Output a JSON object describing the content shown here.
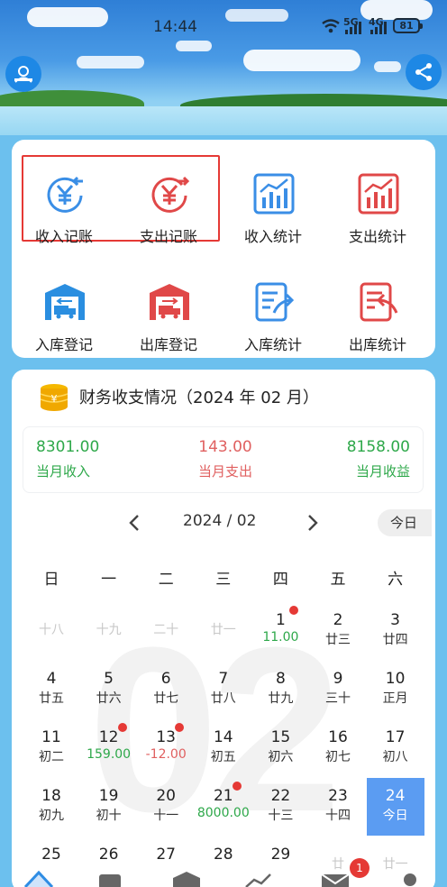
{
  "status_bar": {
    "time": "14:44",
    "network_1": "5G",
    "network_2": "4G",
    "battery": "81"
  },
  "icons": {
    "avatar": "user-icon",
    "share": "share-icon"
  },
  "menu": {
    "items": [
      {
        "label": "收入记账",
        "icon": "income-yen-icon",
        "color": "#3a8ee6"
      },
      {
        "label": "支出记账",
        "icon": "expense-yen-icon",
        "color": "#e04848"
      },
      {
        "label": "收入统计",
        "icon": "income-chart-icon",
        "color": "#3a8ee6"
      },
      {
        "label": "支出统计",
        "icon": "expense-chart-icon",
        "color": "#e04848"
      },
      {
        "label": "入库登记",
        "icon": "inbound-warehouse-icon",
        "color": "#2a8ee0"
      },
      {
        "label": "出库登记",
        "icon": "outbound-warehouse-icon",
        "color": "#e04848"
      },
      {
        "label": "入库统计",
        "icon": "inbound-stats-icon",
        "color": "#3a8ee6"
      },
      {
        "label": "出库统计",
        "icon": "outbound-stats-icon",
        "color": "#e04848"
      }
    ]
  },
  "finance": {
    "title": "财务收支情况（2024 年 02 月）",
    "income_value": "8301.00",
    "income_label": "当月收入",
    "expense_value": "143.00",
    "expense_label": "当月支出",
    "profit_value": "8158.00",
    "profit_label": "当月收益",
    "colors": {
      "income": "#2ea84a",
      "expense": "#e06060",
      "profit": "#2ea84a"
    }
  },
  "calendar": {
    "month_label": "2024 / 02",
    "today_label": "今日",
    "background_number": "02",
    "weekdays": [
      "日",
      "一",
      "二",
      "三",
      "四",
      "五",
      "六"
    ],
    "rows": [
      [
        {
          "n": "",
          "l": "十八",
          "faded": true
        },
        {
          "n": "",
          "l": "十九",
          "faded": true
        },
        {
          "n": "",
          "l": "二十",
          "faded": true
        },
        {
          "n": "",
          "l": "廿一",
          "faded": true
        },
        {
          "n": "1",
          "l": "11.00",
          "amount": "income",
          "dot": true
        },
        {
          "n": "2",
          "l": "廿三"
        },
        {
          "n": "3",
          "l": "廿四"
        }
      ],
      [
        {
          "n": "4",
          "l": "廿五"
        },
        {
          "n": "5",
          "l": "廿六"
        },
        {
          "n": "6",
          "l": "廿七"
        },
        {
          "n": "7",
          "l": "廿八"
        },
        {
          "n": "8",
          "l": "廿九"
        },
        {
          "n": "9",
          "l": "三十"
        },
        {
          "n": "10",
          "l": "正月"
        }
      ],
      [
        {
          "n": "11",
          "l": "初二"
        },
        {
          "n": "12",
          "l": "159.00",
          "amount": "income",
          "dot": true
        },
        {
          "n": "13",
          "l": "-12.00",
          "amount": "expense",
          "dot": true
        },
        {
          "n": "14",
          "l": "初五"
        },
        {
          "n": "15",
          "l": "初六"
        },
        {
          "n": "16",
          "l": "初七"
        },
        {
          "n": "17",
          "l": "初八"
        }
      ],
      [
        {
          "n": "18",
          "l": "初九"
        },
        {
          "n": "19",
          "l": "初十"
        },
        {
          "n": "20",
          "l": "十一"
        },
        {
          "n": "21",
          "l": "8000.00",
          "amount": "income",
          "dot": true
        },
        {
          "n": "22",
          "l": "十三"
        },
        {
          "n": "23",
          "l": "十四"
        },
        {
          "n": "24",
          "l": "今日",
          "today": true
        }
      ],
      [
        {
          "n": "25",
          "l": ""
        },
        {
          "n": "26",
          "l": ""
        },
        {
          "n": "27",
          "l": ""
        },
        {
          "n": "28",
          "l": ""
        },
        {
          "n": "29",
          "l": ""
        },
        {
          "n": "",
          "l": "廿",
          "faded": true
        },
        {
          "n": "",
          "l": "廿一",
          "faded": true
        }
      ]
    ]
  },
  "bottom_nav": {
    "tabs": [
      {
        "icon": "home-icon"
      },
      {
        "icon": "document-icon"
      },
      {
        "icon": "box-icon"
      },
      {
        "icon": "chart-icon"
      },
      {
        "icon": "mail-icon",
        "badge": "1"
      },
      {
        "icon": "profile-icon"
      }
    ]
  }
}
